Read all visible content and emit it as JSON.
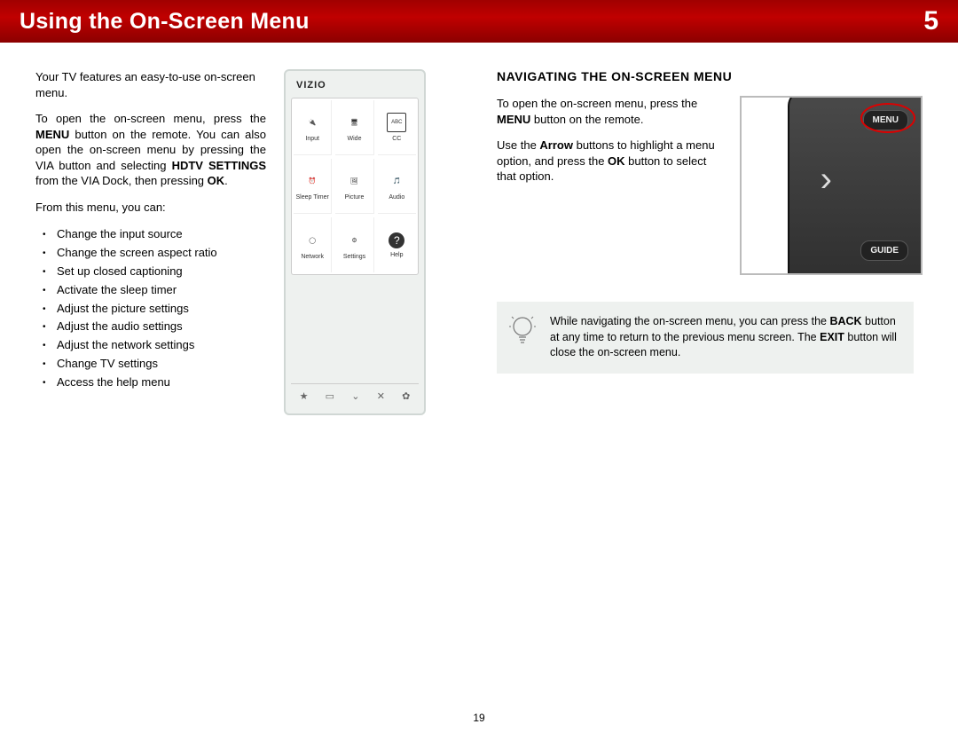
{
  "header": {
    "title": "Using the On-Screen Menu",
    "chapter_number": "5"
  },
  "left": {
    "intro": "Your TV features an easy-to-use on-screen menu.",
    "open_menu_1": "To open the on-screen menu, press the ",
    "open_menu_2": " button on the remote. You can also open the on-screen menu by pressing the VIA button and selecting ",
    "open_menu_3": " from the VIA Dock, then pressing ",
    "menu_bold": "MENU",
    "hdtv_settings_bold": "HDTV SETTINGS",
    "ok_bold": "OK",
    "period": ".",
    "from_this": "From this menu, you can:",
    "bullets": [
      "Change the input source",
      "Change the screen aspect ratio",
      "Set up closed captioning",
      "Activate the sleep timer",
      "Adjust the picture settings",
      "Adjust the audio settings",
      "Adjust the network settings",
      "Change TV settings",
      "Access the help menu"
    ]
  },
  "menu_mock": {
    "brand": "VIZIO",
    "cells": [
      "Input",
      "Wide",
      "CC",
      "Sleep Timer",
      "Picture",
      "Audio",
      "Network",
      "Settings",
      "Help"
    ]
  },
  "right": {
    "heading": "NAVIGATING THE ON-SCREEN MENU",
    "para1_a": "To open the on-screen menu, press the ",
    "para1_menu": "MENU",
    "para1_b": " button on the remote.",
    "para2_a": "Use the ",
    "para2_arrow": "Arrow",
    "para2_b": " buttons to highlight a menu option, and press the ",
    "para2_ok": "OK",
    "para2_c": " button to select that option.",
    "remote_menu_label": "MENU",
    "remote_guide_label": "GUIDE"
  },
  "tip": {
    "a": "While navigating the on-screen menu, you can press the ",
    "back": "BACK",
    "b": " button at any time to return to the previous menu screen. The ",
    "exit": "EXIT",
    "c": " button will close the on-screen menu."
  },
  "page_number": "19"
}
